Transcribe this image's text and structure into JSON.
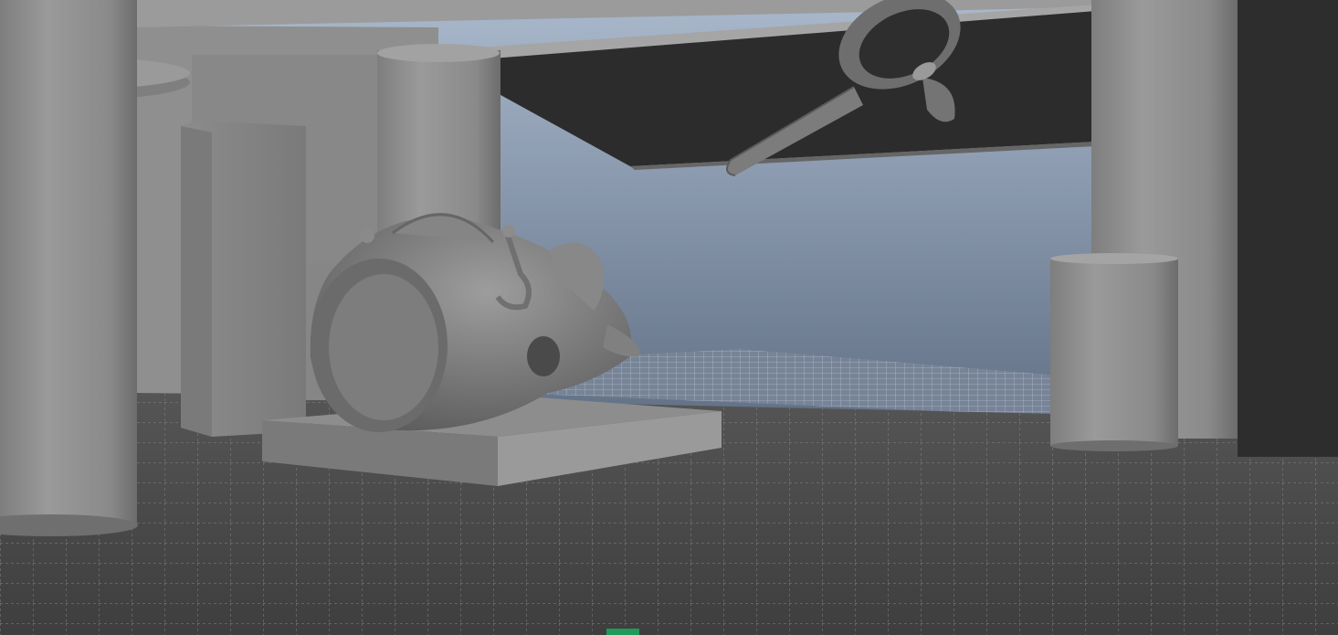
{
  "viewport": {
    "kind": "3d-perspective-viewport",
    "shading": "smooth-shaded-gray",
    "grid": "on",
    "background_gradient": [
      "#9fb0c4",
      "#5f6f86"
    ],
    "floor_color": "#4a4a4a",
    "grid_line_color": "#b8b8b8",
    "object_color": "#8f8f8f",
    "overhang_color": "#2c2c2c",
    "origin_marker_color": "#1f9a5a"
  },
  "scene_objects": [
    {
      "name": "pillar-left"
    },
    {
      "name": "ring-ledge"
    },
    {
      "name": "back-wall"
    },
    {
      "name": "box-tall"
    },
    {
      "name": "pillar-center"
    },
    {
      "name": "ceiling-overhang"
    },
    {
      "name": "propeller"
    },
    {
      "name": "pillar-right"
    },
    {
      "name": "cylinder-short"
    },
    {
      "name": "pedestal"
    },
    {
      "name": "diving-helmet"
    }
  ]
}
